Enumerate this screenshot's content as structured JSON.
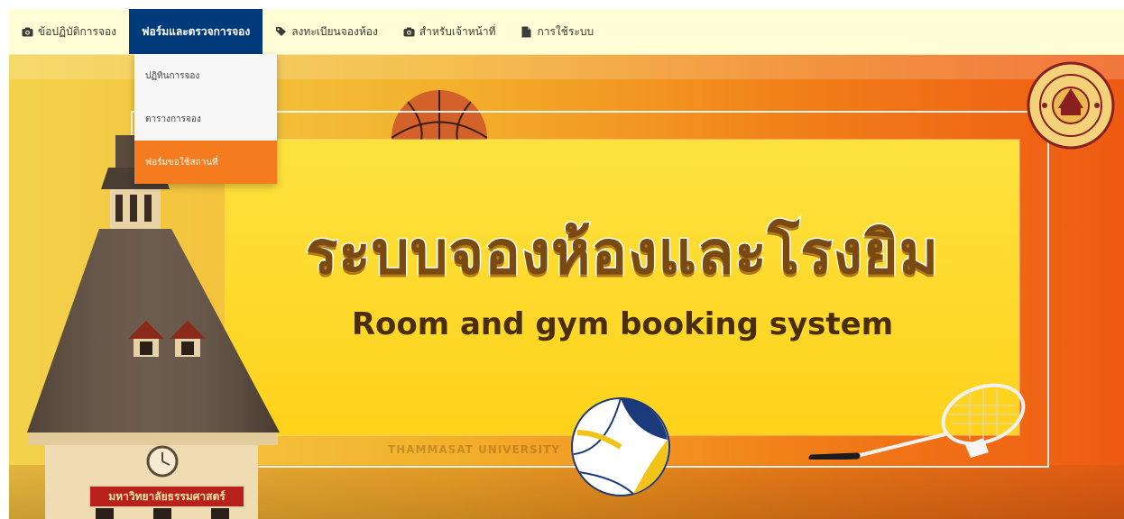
{
  "nav": {
    "items": [
      {
        "label": "ข้อปฏิบัติการจอง",
        "icon": "camera-icon"
      },
      {
        "label": "ฟอร์มและตรวจการจอง",
        "icon": "",
        "active": true
      },
      {
        "label": "ลงทะเบียนจองห้อง",
        "icon": "tag-icon"
      },
      {
        "label": "สำหรับเจ้าหน้าที่",
        "icon": "camera-icon"
      },
      {
        "label": "การใช้ระบบ",
        "icon": "file-icon"
      }
    ]
  },
  "dropdown": {
    "items": [
      {
        "label": "ปฏิทินการจอง"
      },
      {
        "label": "ตารางการจอง"
      },
      {
        "label": "ฟอร์มขอใช้สถานที่",
        "selected": true
      }
    ]
  },
  "banner": {
    "title_th": "ระบบจองห้องและโรงยิม",
    "title_en": "Room and gym booking system",
    "building_sign": "มหาวิทยาลัยธรรมศาสตร์",
    "watermark": "THAMMASAT UNIVERSITY",
    "seal_text": "THAMMASAT UNIVERSITY"
  },
  "colors": {
    "nav_bg": "#fffdd6",
    "nav_active": "#003a7a",
    "dropdown_selected": "#f47c1e",
    "banner_start": "#f4d34c",
    "banner_end": "#ee5a12",
    "panel": "#ffd21b"
  }
}
